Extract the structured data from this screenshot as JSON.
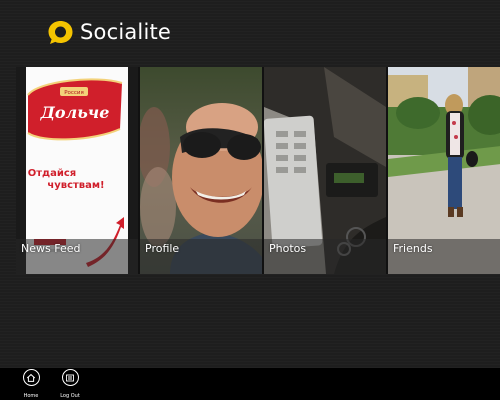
{
  "app": {
    "title": "Socialite",
    "accent_color": "#f5c400"
  },
  "tiles": [
    {
      "label": "News Feed",
      "image": "Dolce product advertisement"
    },
    {
      "label": "Profile",
      "image": "smiling man in sunglasses"
    },
    {
      "label": "Photos",
      "image": "desk with phone and keys"
    },
    {
      "label": "Friends",
      "image": "woman standing in park"
    }
  ],
  "ad": {
    "brand": "Россия",
    "name": "Дольче",
    "tagline_1": "Отдайся",
    "tagline_2": "чувствам!"
  },
  "appbar": {
    "buttons": [
      {
        "label": "Home",
        "icon": "home-icon"
      },
      {
        "label": "Log Out",
        "icon": "logout-icon"
      }
    ]
  }
}
